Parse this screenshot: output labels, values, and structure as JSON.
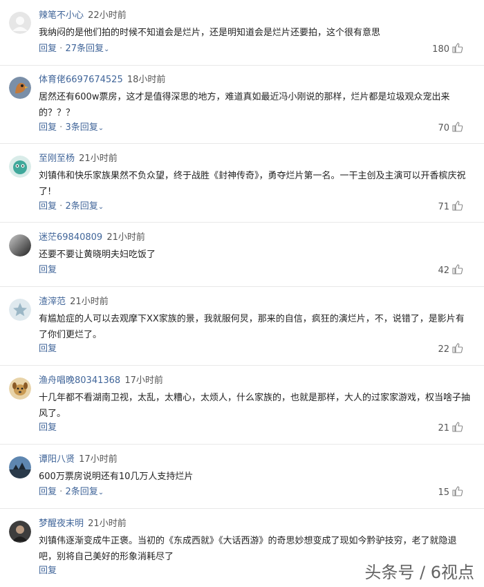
{
  "comments": [
    {
      "username": "辣笔不小心",
      "time": "22小时前",
      "text": "我纳闷的是他们拍的时候不知道会是烂片，还是明知道会是烂片还要拍，这个很有意思",
      "reply_label": "回复",
      "sep": "·",
      "replies_label": "27条回复",
      "likes": "180",
      "avatar": "gray-default-avatar"
    },
    {
      "username": "体育佬6697674525",
      "time": "18小时前",
      "text": "居然还有600w票房，这才是值得深思的地方，难道真如最近冯小刚说的那样，烂片都是垃圾观众宠出来的？？？",
      "reply_label": "回复",
      "sep": "·",
      "replies_label": "3条回复",
      "likes": "70",
      "avatar": "bird-avatar"
    },
    {
      "username": "至刚至杨",
      "time": "21小时前",
      "text": "刘镇伟和快乐家族果然不负众望，终于战胜《封神传奇》，勇夺烂片第一名。一干主创及主演可以开香槟庆祝了!",
      "reply_label": "回复",
      "sep": "·",
      "replies_label": "2条回复",
      "likes": "71",
      "avatar": "teal-creature-avatar"
    },
    {
      "username": "迷茫69840809",
      "time": "21小时前",
      "text": "还要不要让黄晓明夫妇吃饭了",
      "reply_label": "回复",
      "sep": "",
      "replies_label": "",
      "likes": "42",
      "avatar": "dark-gradient-avatar"
    },
    {
      "username": "渣滓范",
      "time": "21小时前",
      "text": "有尴尬症的人可以去观摩下XX家族的景，我就服何炅，那来的自信，疯狂的演烂片，不，说错了，是影片有了你们更烂了。",
      "reply_label": "回复",
      "sep": "",
      "replies_label": "",
      "likes": "22",
      "avatar": "star-avatar"
    },
    {
      "username": "渔舟唱晚80341368",
      "time": "17小时前",
      "text": "十几年都不看湖南卫视，太乱，太糟心，太烦人，什么家族的，也就是那样，大人的过家家游戏，权当啥子抽风了。",
      "reply_label": "回复",
      "sep": "",
      "replies_label": "",
      "likes": "21",
      "avatar": "dog-avatar"
    },
    {
      "username": "谭阳八贤",
      "time": "17小时前",
      "text": "600万票房说明还有10几万人支持烂片",
      "reply_label": "回复",
      "sep": "·",
      "replies_label": "2条回复",
      "likes": "15",
      "avatar": "landscape-avatar"
    },
    {
      "username": "梦醒夜末明",
      "time": "21小时前",
      "text": "刘镇伟逐渐变成牛正褒。当初的《东成西就》《大话西游》的奇思妙想变成了现如今黔驴技穷，老了就隐退吧，别将自己美好的形象消耗尽了",
      "reply_label": "回复",
      "sep": "",
      "replies_label": "",
      "likes": "",
      "avatar": "portrait-avatar"
    }
  ],
  "watermark": "头条号 / 6视点",
  "colors": {
    "username": "#406599",
    "text": "#222222",
    "meta": "#555555",
    "divider": "#e8e8e8"
  }
}
